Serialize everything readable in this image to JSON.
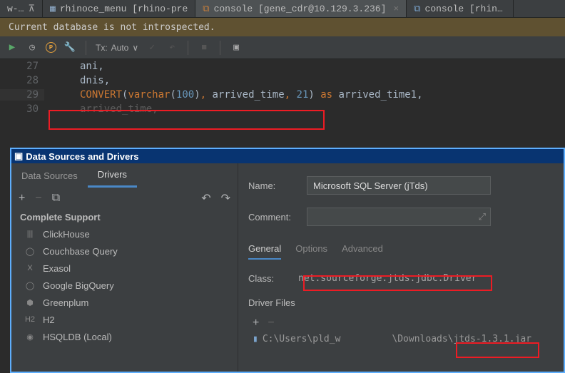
{
  "tabs": [
    {
      "label": "w-new]",
      "pinned": true
    },
    {
      "label": "rhinoce_menu [rhino-pre",
      "table": true
    },
    {
      "label": "console [gene_cdr@10.129.3.236]",
      "active": true,
      "closable": true
    },
    {
      "label": "console [rhino-pr"
    }
  ],
  "warning": "Current database is not introspected.",
  "tx_label": "Tx:",
  "tx_value": "Auto",
  "tx_chevron": "∨",
  "editor": {
    "lines": [
      {
        "n": "27",
        "spans": [
          {
            "t": "ani",
            "c": "id"
          },
          {
            "t": ","
          }
        ]
      },
      {
        "n": "28",
        "spans": [
          {
            "t": "dnis",
            "c": "id"
          },
          {
            "t": ","
          }
        ]
      },
      {
        "n": "29",
        "current": true,
        "spans": [
          {
            "t": "CONVERT",
            "c": "kw"
          },
          {
            "t": "(",
            "c": "paren"
          },
          {
            "t": "varchar",
            "c": "kw"
          },
          {
            "t": "(",
            "c": "paren"
          },
          {
            "t": "100",
            "c": "num"
          },
          {
            "t": ")",
            "c": "paren"
          },
          {
            "t": ", ",
            "c": "comma"
          },
          {
            "t": "arrived_time",
            "c": "id"
          },
          {
            "t": ", ",
            "c": "comma"
          },
          {
            "t": "21",
            "c": "num"
          },
          {
            "t": ")",
            "c": "paren"
          },
          {
            "t": " as ",
            "c": "as"
          },
          {
            "t": "arrived_time1",
            "c": "id"
          },
          {
            "t": ","
          }
        ]
      },
      {
        "n": "30",
        "dim": true,
        "spans": [
          {
            "t": "arrived_time",
            "c": "dim"
          },
          {
            "t": ",",
            "c": "dim"
          }
        ]
      }
    ]
  },
  "dialog": {
    "title": "Data Sources and Drivers",
    "left_tabs": {
      "a": "Data Sources",
      "b": "Drivers"
    },
    "section": "Complete Support",
    "drivers": [
      {
        "name": "ClickHouse",
        "icon": "|||"
      },
      {
        "name": "Couchbase Query",
        "icon": "◯"
      },
      {
        "name": "Exasol",
        "icon": "X"
      },
      {
        "name": "Google BigQuery",
        "icon": "◯"
      },
      {
        "name": "Greenplum",
        "icon": "⬢"
      },
      {
        "name": "H2",
        "icon": "H2"
      },
      {
        "name": "HSQLDB (Local)",
        "icon": "◉"
      }
    ],
    "name_label": "Name:",
    "name_value": "Microsoft SQL Server (jTds)",
    "comment_label": "Comment:",
    "rtabs": {
      "a": "General",
      "b": "Options",
      "c": "Advanced"
    },
    "class_label": "Class:",
    "class_value": "net.sourceforge.jtds.jdbc.Driver",
    "files_label": "Driver Files",
    "file_prefix": "C:\\Users\\pld_w",
    "file_mid": "\\Downloads",
    "file_tail": "\\jtds-1.3.1.jar"
  }
}
